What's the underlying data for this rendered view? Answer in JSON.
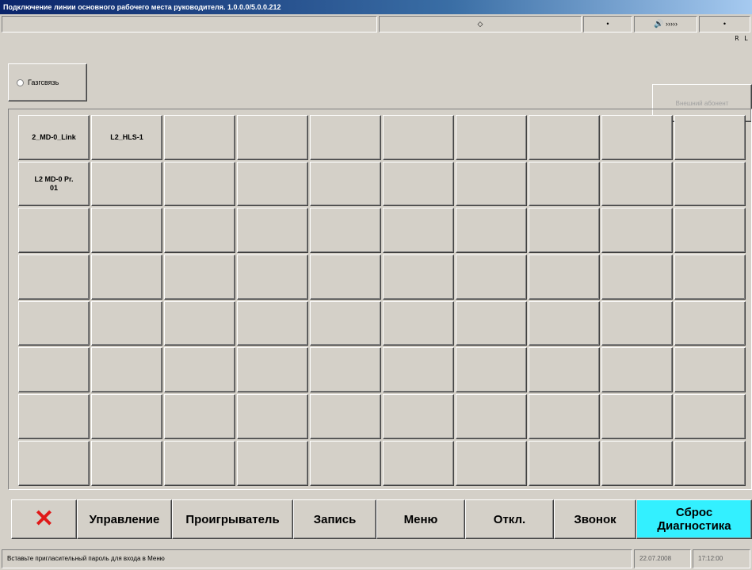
{
  "window": {
    "title": "Подключение линии основного рабочего места руководителя. 1.0.0.0/5.0.0.212"
  },
  "status_row": {
    "center_indicator": "◇",
    "dot": "•",
    "volume_text": "›››››",
    "right_dot": "•",
    "rl_label": "R L"
  },
  "controls": {
    "gg_label": "Газгсвязь",
    "ext_label": "Внешний абонент"
  },
  "grid": {
    "keys": [
      "2_MD-0_Link",
      "L2_HLS-1",
      "",
      "",
      "",
      "",
      "",
      "",
      "",
      "",
      "L2 MD-0 Pr.\n01",
      "",
      "",
      "",
      "",
      "",
      "",
      "",
      "",
      "",
      "",
      "",
      "",
      "",
      "",
      "",
      "",
      "",
      "",
      "",
      "",
      "",
      "",
      "",
      "",
      "",
      "",
      "",
      "",
      "",
      "",
      "",
      "",
      "",
      "",
      "",
      "",
      "",
      "",
      "",
      "",
      "",
      "",
      "",
      "",
      "",
      "",
      "",
      "",
      "",
      "",
      "",
      "",
      "",
      "",
      "",
      "",
      "",
      "",
      "",
      "",
      "",
      "",
      "",
      "",
      "",
      "",
      "",
      "",
      ""
    ]
  },
  "bottom": {
    "cancel_icon": "close-icon",
    "buttons": [
      "Управление",
      "Проигрыватель",
      "Запись",
      "Меню",
      "Откл.",
      "Звонок",
      "Сброс\nДиагностика"
    ]
  },
  "statusbar": {
    "message": "Вставьте пригласительный пароль для входа в Меню",
    "date": "22.07.2008",
    "time": "17:12:00"
  },
  "colors": {
    "accent_cyan": "#33f0ff",
    "cancel_red": "#e01818"
  }
}
